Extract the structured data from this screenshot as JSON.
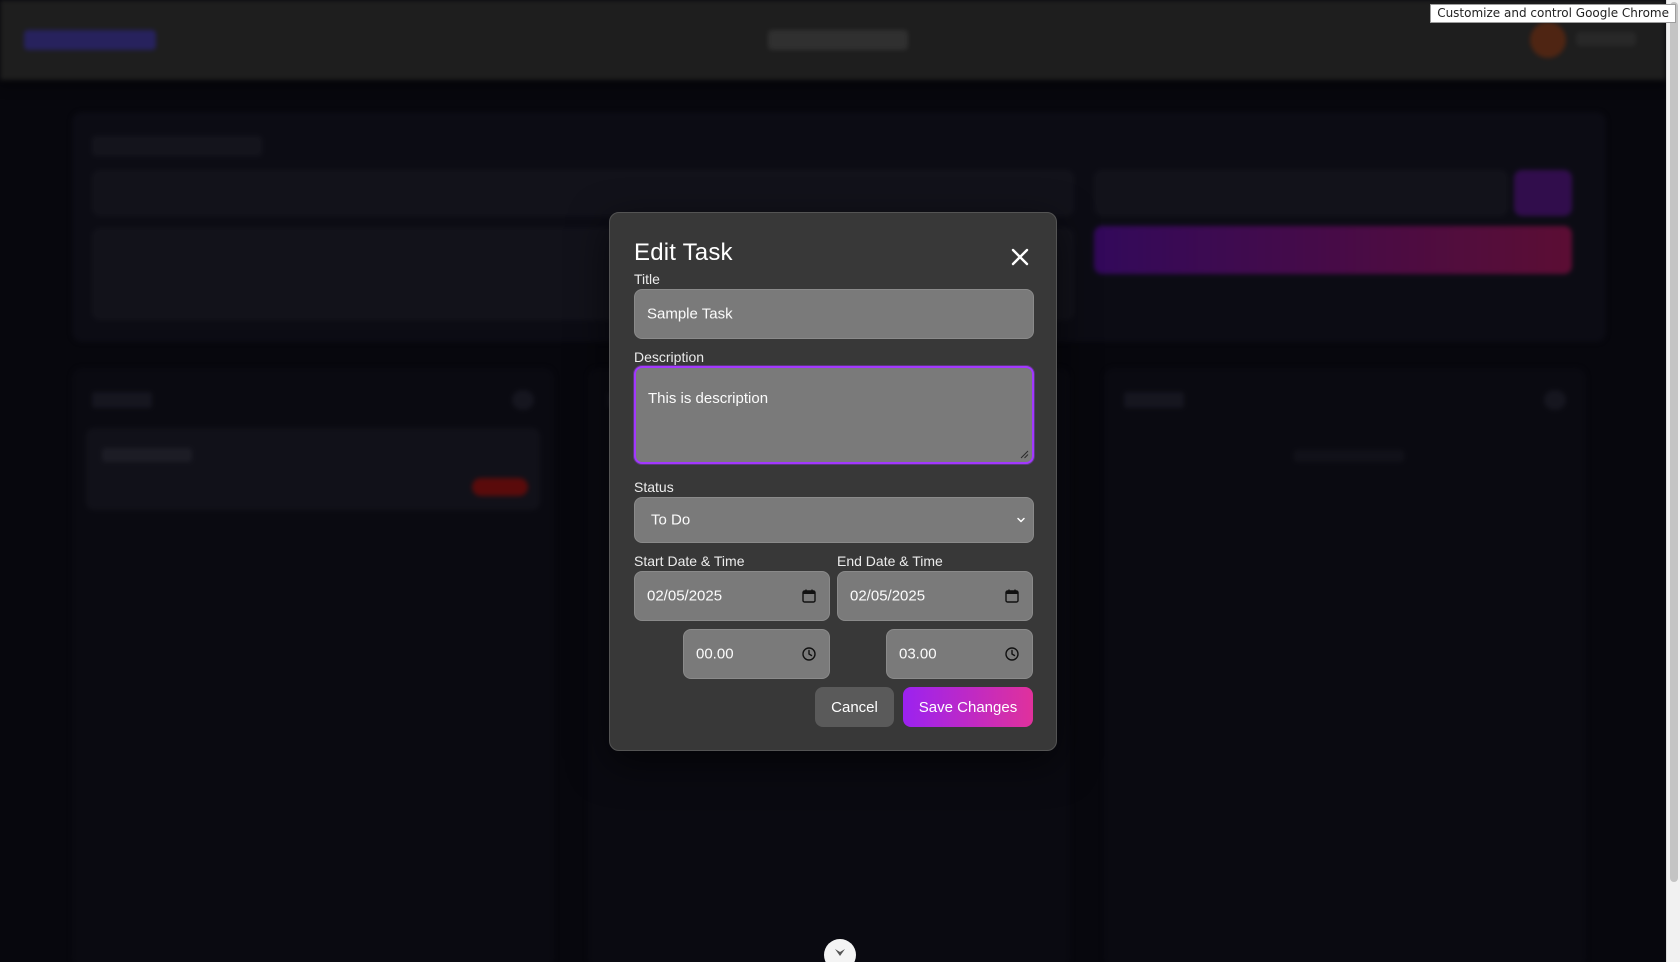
{
  "browser": {
    "tooltip": "Customize and control Google Chrome"
  },
  "modal": {
    "title": "Edit Task",
    "close_icon": "close-icon",
    "fields": {
      "title": {
        "label": "Title",
        "value": "Sample Task"
      },
      "description": {
        "label": "Description",
        "value": "This is description"
      },
      "status": {
        "label": "Status",
        "selected": "To Do"
      },
      "start": {
        "label": "Start Date & Time",
        "date": "02/05/2025",
        "time": "00.00"
      },
      "end": {
        "label": "End Date & Time",
        "date": "02/05/2025",
        "time": "03.00"
      }
    },
    "buttons": {
      "cancel": "Cancel",
      "save": "Save Changes"
    }
  },
  "colors": {
    "accent_start": "#9b22f0",
    "accent_end": "#e0319c",
    "focus_ring": "#a238ff",
    "modal_bg": "#383838",
    "field_bg": "#7a7a7a"
  }
}
